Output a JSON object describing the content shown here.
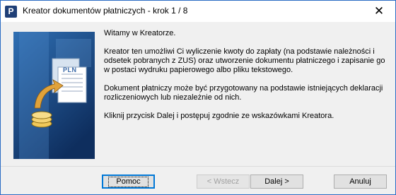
{
  "window": {
    "title": "Kreator dokumentów płatniczych - krok 1 / 8",
    "app_icon_glyph": "P",
    "close_glyph": "✕"
  },
  "banner": {
    "logo_text": "PLN",
    "icon": "document-money-icon"
  },
  "content": {
    "paragraph1": "Witamy w Kreatorze.",
    "paragraph2": "Kreator ten umożliwi Ci wyliczenie kwoty do zapłaty (na podstawie należności i odsetek pobranych z ZUS) oraz utworzenie dokumentu płatniczego i zapisanie go w postaci wydruku papierowego albo pliku tekstowego.",
    "paragraph3": "Dokument płatniczy może być przygotowany na podstawie istniejących deklaracji rozliczeniowych lub niezależnie od nich.",
    "paragraph4": "Kliknij przycisk Dalej i postępuj zgodnie ze wskazówkami Kreatora."
  },
  "buttons": {
    "help": "Pomoc",
    "back": "< Wstecz",
    "next": "Dalej >",
    "cancel": "Anuluj"
  }
}
